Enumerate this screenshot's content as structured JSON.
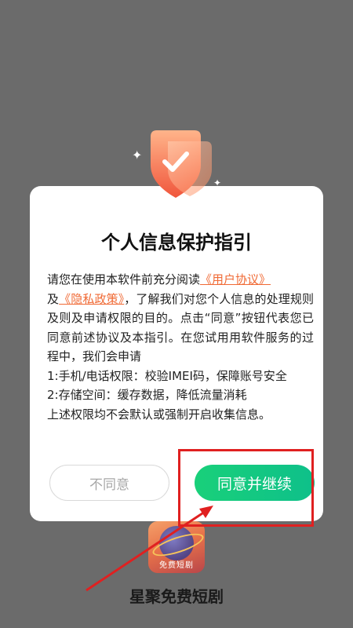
{
  "app": {
    "name": "星聚免费短剧",
    "icon_label": "免费短剧"
  },
  "dialog": {
    "title": "个人信息保护指引",
    "body": {
      "p1": "请您在使用本软件前充分阅读",
      "link_user_agreement": "《用户协议》",
      "p2": "及",
      "link_privacy_policy": "《隐私政策》",
      "p3": "，了解我们对您个人信息的处理规则及则及申请权限的目的。点击“同意”按钮代表您已同意前述协议及本指引。在您试用用软件服务的过程中，我们会申请",
      "line_permission_1": "1:手机/电话权限：校验IMEI码，保障账号安全",
      "line_permission_2": "2:存储空间：缓存数据，降低流量消耗",
      "line_footer": "上述权限均不会默认或强制开启收集信息。"
    },
    "buttons": {
      "decline": "不同意",
      "accept": "同意并继续"
    }
  },
  "colors": {
    "overlay": "#6b6b6b",
    "link": "#f06a35",
    "accept": "#19d07a",
    "annotation": "#e02020"
  }
}
